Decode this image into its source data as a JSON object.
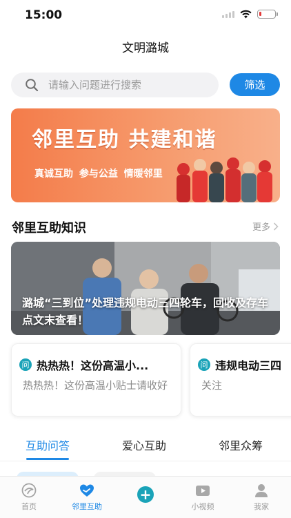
{
  "status_bar": {
    "time": "15:00",
    "battery_level": 0.15
  },
  "nav": {
    "title": "文明潞城"
  },
  "search": {
    "placeholder": "请输入问题进行搜索",
    "filter_label": "筛选"
  },
  "banner": {
    "title": "邻里互助 共建和谐",
    "subtitle": "真诚互助 参与公益 情暖邻里"
  },
  "knowledge": {
    "title": "邻里互助知识",
    "more_label": "更多",
    "featured_caption": "潞城“三到位”处理违规电动三四轮车，回收及存车点文末查看！"
  },
  "qa_cards": [
    {
      "badge": "问",
      "title": "热热热！这份高温小...",
      "desc": "热热热！这份高温小贴士请收好"
    },
    {
      "badge": "问",
      "title": "违规电动三四",
      "desc": "关注"
    }
  ],
  "tabs": [
    {
      "label": "互助问答",
      "active": true
    },
    {
      "label": "爱心互助",
      "active": false
    },
    {
      "label": "邻里众筹",
      "active": false
    }
  ],
  "tabbar": [
    {
      "label": "首页",
      "icon": "home-icon",
      "active": false
    },
    {
      "label": "邻里互助",
      "icon": "heart-hand-icon",
      "active": true
    },
    {
      "label": "",
      "icon": "plus-icon",
      "active": false
    },
    {
      "label": "小视频",
      "icon": "video-icon",
      "active": false
    },
    {
      "label": "我家",
      "icon": "user-icon",
      "active": false
    }
  ],
  "colors": {
    "accent": "#1e88e5",
    "badge": "#1aa3b8",
    "banner": "#f47c4a"
  }
}
